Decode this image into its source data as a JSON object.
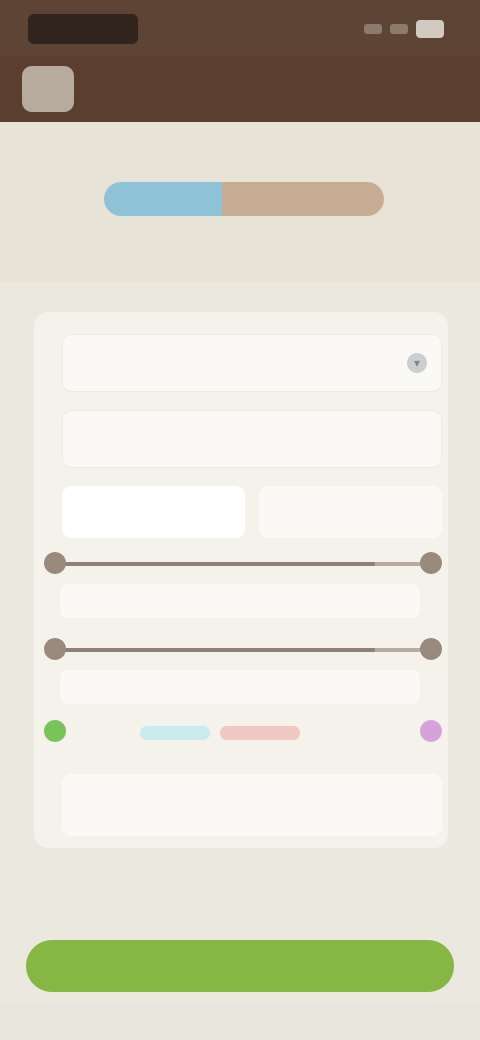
{
  "status_bar": {
    "time": "",
    "icons": [
      "signal-icon",
      "wifi-icon",
      "battery-icon"
    ]
  },
  "app_bar": {
    "title": "",
    "icon": "app-logo-icon"
  },
  "header": {
    "left_label": "",
    "right_label": "",
    "segments": [
      {
        "label": ""
      },
      {
        "label": ""
      }
    ]
  },
  "form": {
    "select_value": "",
    "text_value": "",
    "text_placeholder": "",
    "radio_options": [
      {
        "label": ""
      },
      {
        "label": ""
      }
    ],
    "slider1": {
      "value_label": "",
      "level": 0.85
    },
    "slider2": {
      "value_label": "",
      "level": 0.85
    },
    "color_caption": "",
    "colors": {
      "green": "#7ac25b",
      "cyan": "#bfe8ef",
      "pink": "#f0bbb6",
      "purple": "#d7a2db"
    },
    "note_placeholder": ""
  },
  "actions": {
    "secondary_label": "",
    "primary_label": ""
  },
  "theme": {
    "status_bar_bg": "#5e4434",
    "app_bar_bg": "#5b3e2e",
    "page_bg": "#ebe8df",
    "seg_a": "#8dc2d9",
    "seg_b": "#c8ac94",
    "primary": "#86b744"
  }
}
